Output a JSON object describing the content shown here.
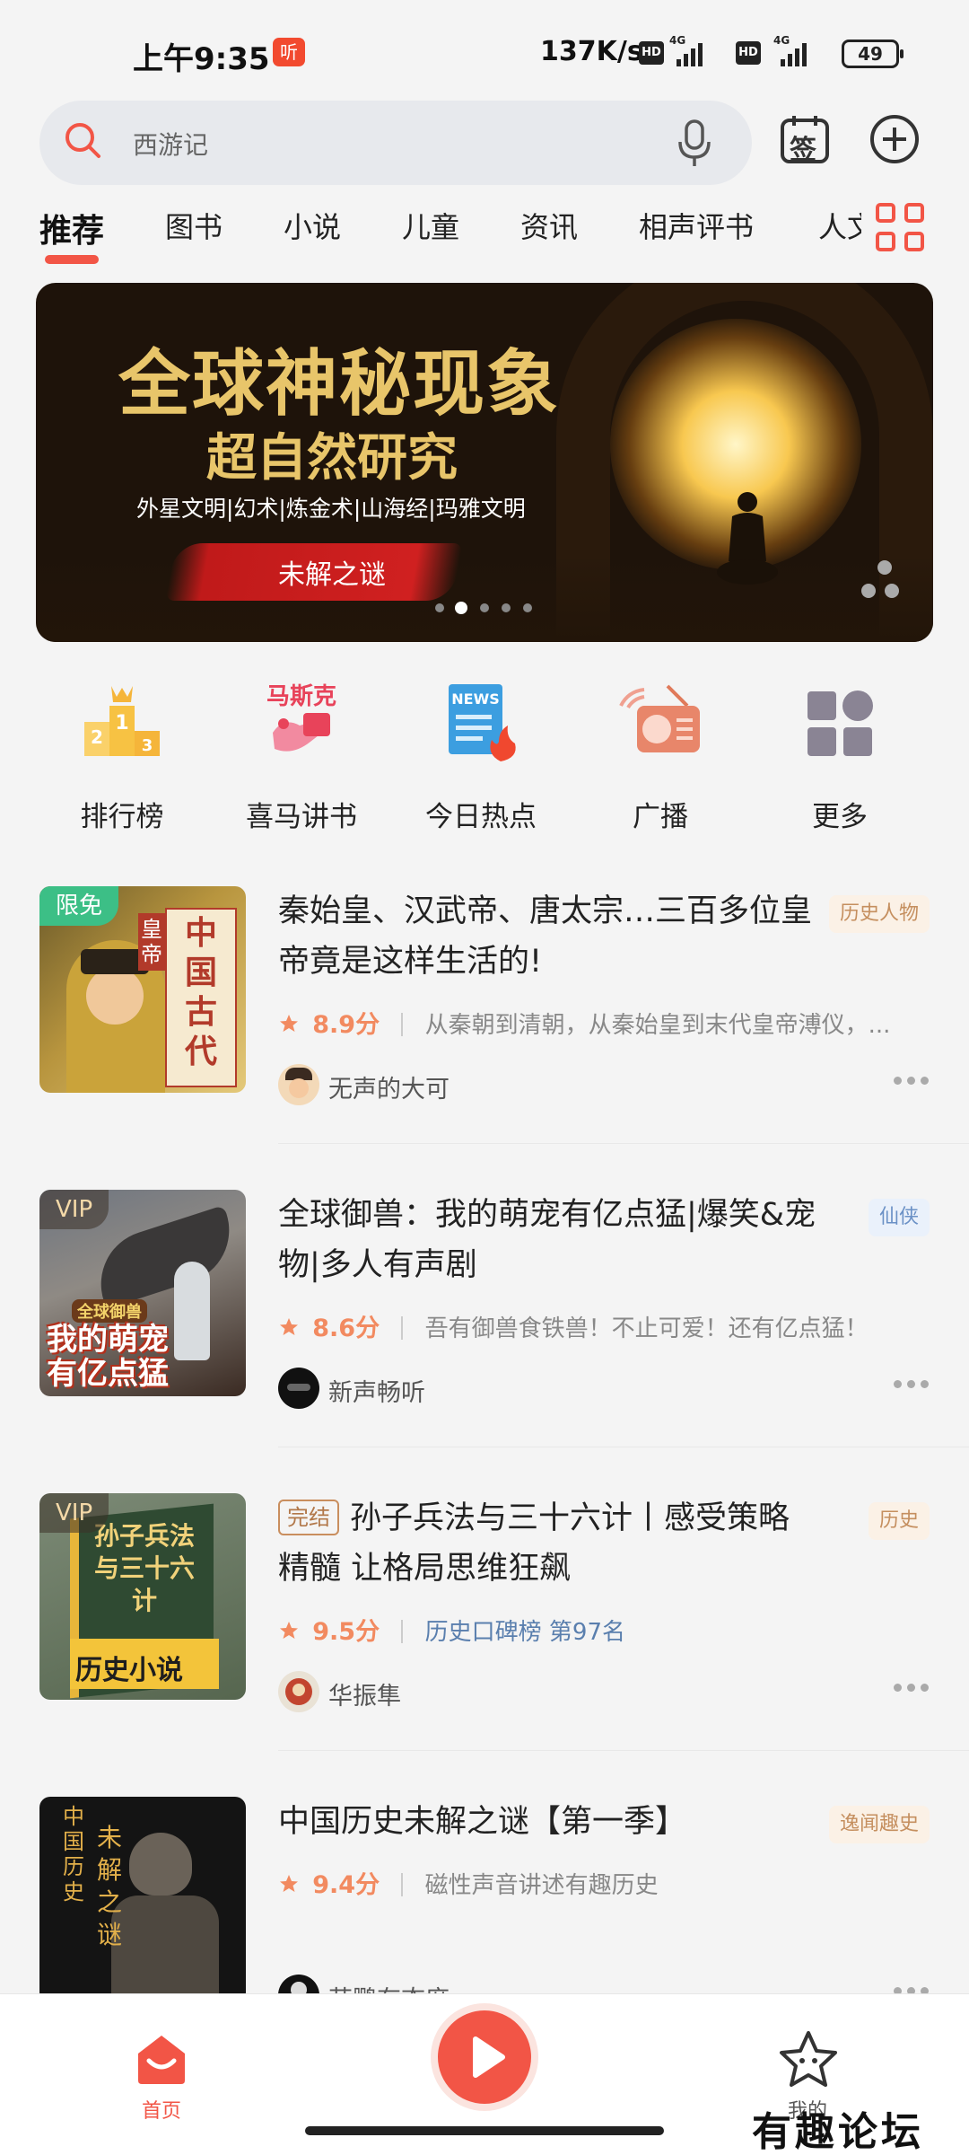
{
  "status_bar": {
    "time": "上午9:35",
    "app_icon_text": "听",
    "net_speed": "137K/s",
    "hd_label": "HD",
    "signal_label": "4G",
    "battery": "49"
  },
  "search": {
    "placeholder": "西游记"
  },
  "header": {
    "signin_label": "签"
  },
  "tabs": [
    "推荐",
    "图书",
    "小说",
    "儿童",
    "资讯",
    "相声评书",
    "人文"
  ],
  "banner": {
    "title": "全球神秘现象",
    "subtitle": "超自然研究",
    "topics": "外星文明|幻术|炼金术|山海经|玛雅文明",
    "button": "未解之谜",
    "page_count": 5,
    "active_page": 2
  },
  "categories": [
    {
      "label": "排行榜",
      "icon": "ranking-podium-icon"
    },
    {
      "label": "喜马讲书",
      "icon": "book-talk-icon",
      "icon_text": "马斯克"
    },
    {
      "label": "今日热点",
      "icon": "news-hot-icon",
      "icon_text": "NEWS"
    },
    {
      "label": "广播",
      "icon": "radio-icon"
    },
    {
      "label": "更多",
      "icon": "more-grid-icon"
    }
  ],
  "items": [
    {
      "badge": "限免",
      "title": "秦始皇、汉武帝、唐太宗…三百多位皇帝竟是这样生活的!",
      "tag": "历史人物",
      "score": "8.9分",
      "desc": "从秦朝到清朝，从秦始皇到末代皇帝溥仪，...",
      "author": "无声的大可",
      "cover_text": "中国古代",
      "cover_text2": "皇帝"
    },
    {
      "badge": "VIP",
      "title": "全球御兽：我的萌宠有亿点猛|爆笑&宠物|多人有声剧",
      "tag": "仙侠",
      "score": "8.6分",
      "desc": "吾有御兽食铁兽！不止可爱！还有亿点猛！",
      "author": "新声畅听",
      "cover_text": "我的萌宠有亿点猛",
      "cover_text2": "全球御兽"
    },
    {
      "badge": "VIP",
      "finished": "完结",
      "title": "孙子兵法与三十六计丨感受策略精髓 让格局思维狂飙",
      "tag": "历史",
      "score": "9.5分",
      "desc": "历史口碑榜 第97名",
      "author": "华振隼",
      "cover_text": "孙子兵法与三十六计",
      "cover_text2": "历史小说"
    },
    {
      "title": "中国历史未解之谜【第一季】",
      "tag": "逸闻趣史",
      "score": "9.4分",
      "desc": "磁性声音讲述有趣历史",
      "author": "苏鹏有态度",
      "cover_text": "中国历史",
      "cover_text2": "未解之谜"
    }
  ],
  "bottom_nav": {
    "home_label": "首页",
    "me_label": "我的"
  },
  "watermark": "有趣论坛",
  "colors": {
    "accent": "#f25546",
    "score": "#f28a60",
    "tag_orange_bg": "#fbf1e6",
    "tag_blue_bg": "#eaf1fb"
  }
}
